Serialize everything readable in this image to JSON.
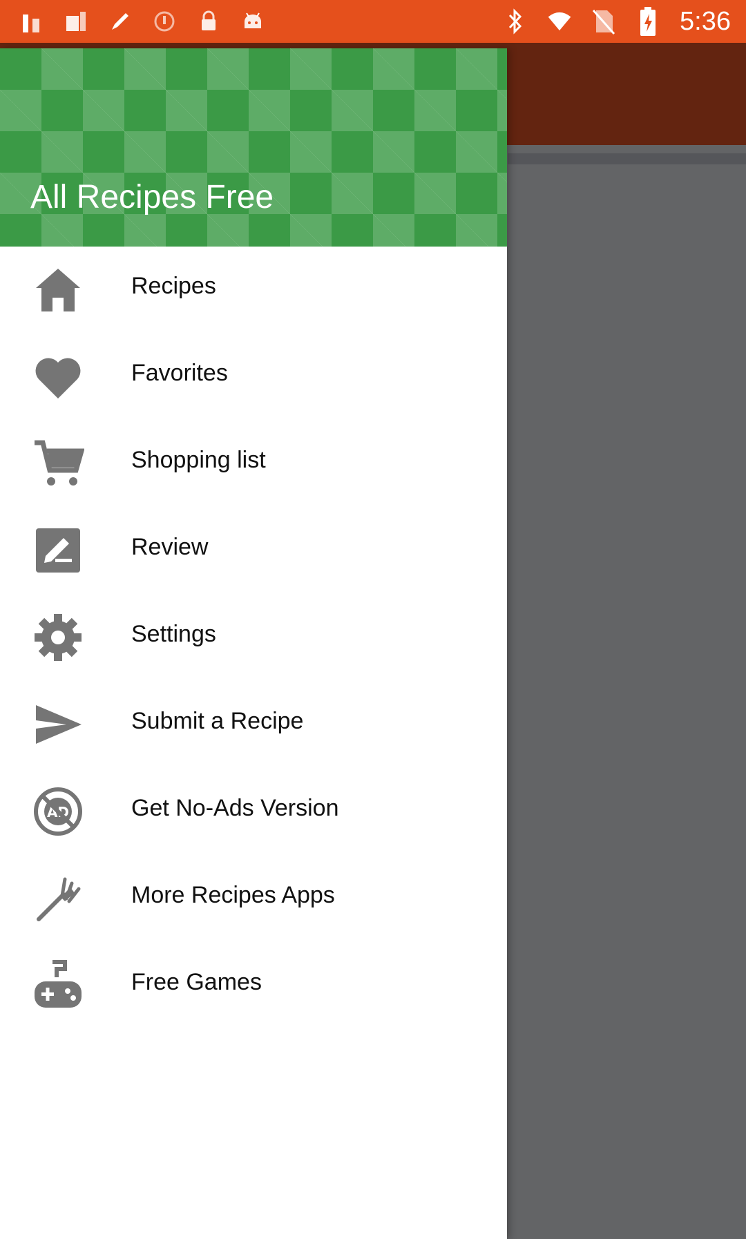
{
  "status_bar": {
    "time": "5:36",
    "colors": {
      "background": "#E5501C",
      "icon": "#ffffff"
    },
    "left_icons": [
      "notification-a-icon",
      "notification-b-icon",
      "pen-icon",
      "nfc-icon",
      "lock-icon",
      "android-icon"
    ],
    "right_icons": [
      "bluetooth-icon",
      "wifi-icon",
      "no-sim-icon",
      "battery-charging-icon"
    ]
  },
  "drawer": {
    "title": "All Recipes Free",
    "header_color": "#3b9a46",
    "items": [
      {
        "label": "Recipes",
        "icon": "home-icon"
      },
      {
        "label": "Favorites",
        "icon": "heart-icon"
      },
      {
        "label": "Shopping list",
        "icon": "cart-icon"
      },
      {
        "label": "Review",
        "icon": "rate-review-icon"
      },
      {
        "label": "Settings",
        "icon": "gear-icon"
      },
      {
        "label": "Submit a Recipe",
        "icon": "send-icon"
      },
      {
        "label": "Get No-Ads Version",
        "icon": "no-ads-icon"
      },
      {
        "label": "More Recipes Apps",
        "icon": "fork-icon"
      },
      {
        "label": "Free Games",
        "icon": "gamepad-icon"
      }
    ]
  },
  "background_app": {
    "toolbar_color": "#632410",
    "scrim_color": "#636466"
  }
}
